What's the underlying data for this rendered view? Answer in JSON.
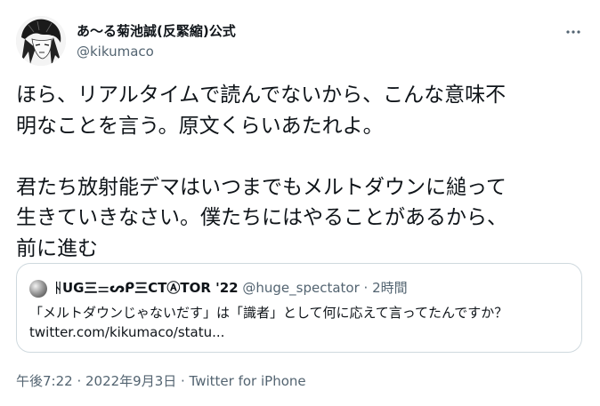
{
  "author": {
    "display_name": "あ〜る菊池誠(反緊縮)公式",
    "handle": "@kikumaco",
    "avatar_icon": "avatar-icon"
  },
  "tweet": {
    "lines": [
      "ほら、リアルタイムで読んでないから、こんな意味不",
      "明なことを言う。原文くらいあたれよ。",
      "",
      "君たち放射能デマはいつまでもメルトダウンに縋って",
      "生きていきなさい。僕たちにはやることがあるから、",
      "前に進む"
    ]
  },
  "quote": {
    "display_name": "ᚺUG㆔⚌ᔕᑭ㆔CTⒶTOR '22",
    "handle": "@huge_spectator",
    "separator": "·",
    "time": "2時間",
    "text": "「メルトダウンじゃないだす」は「識者」として何に応えて言ってたんですか？",
    "link": "twitter.com/kikumaco/statu..."
  },
  "meta": {
    "timestamp": "午後7:22 · 2022年9月3日 · Twitter for iPhone"
  },
  "colors": {
    "text": "#0f1419",
    "secondary": "#536471",
    "border": "#cfd9de"
  }
}
